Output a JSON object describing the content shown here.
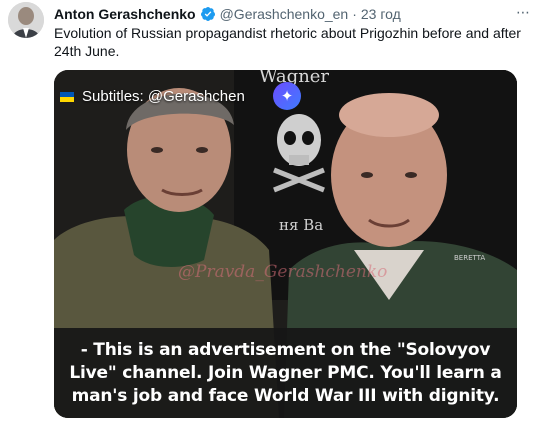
{
  "tweet": {
    "author_name": "Anton Gerashchenko",
    "handle": "@Gerashchenko_en",
    "separator": "·",
    "time": "23 год",
    "text": "Evolution of Russian propagandist rhetoric about Prigozhin before and after 24th June.",
    "more_icon": "more-icon"
  },
  "media": {
    "subtitle_tag": "Subtitles: @Gerashchen",
    "subtitle_tag_tail": "en",
    "sparkle_glyph": "✦",
    "watermark": "@Pravda_Gerashchenko",
    "banner_text": "Wagner",
    "banner_text2": "ня Ва",
    "patch_text": "BERETTA",
    "caption": "- This is an advertisement on the \"Solovyov Live\" channel. Join Wagner PMC. You'll learn a man's job and face World War III with dignity."
  },
  "colors": {
    "verified": "#1d9bf0",
    "muted": "#536471",
    "flag_top": "#0057b7",
    "flag_bottom": "#ffd700"
  }
}
